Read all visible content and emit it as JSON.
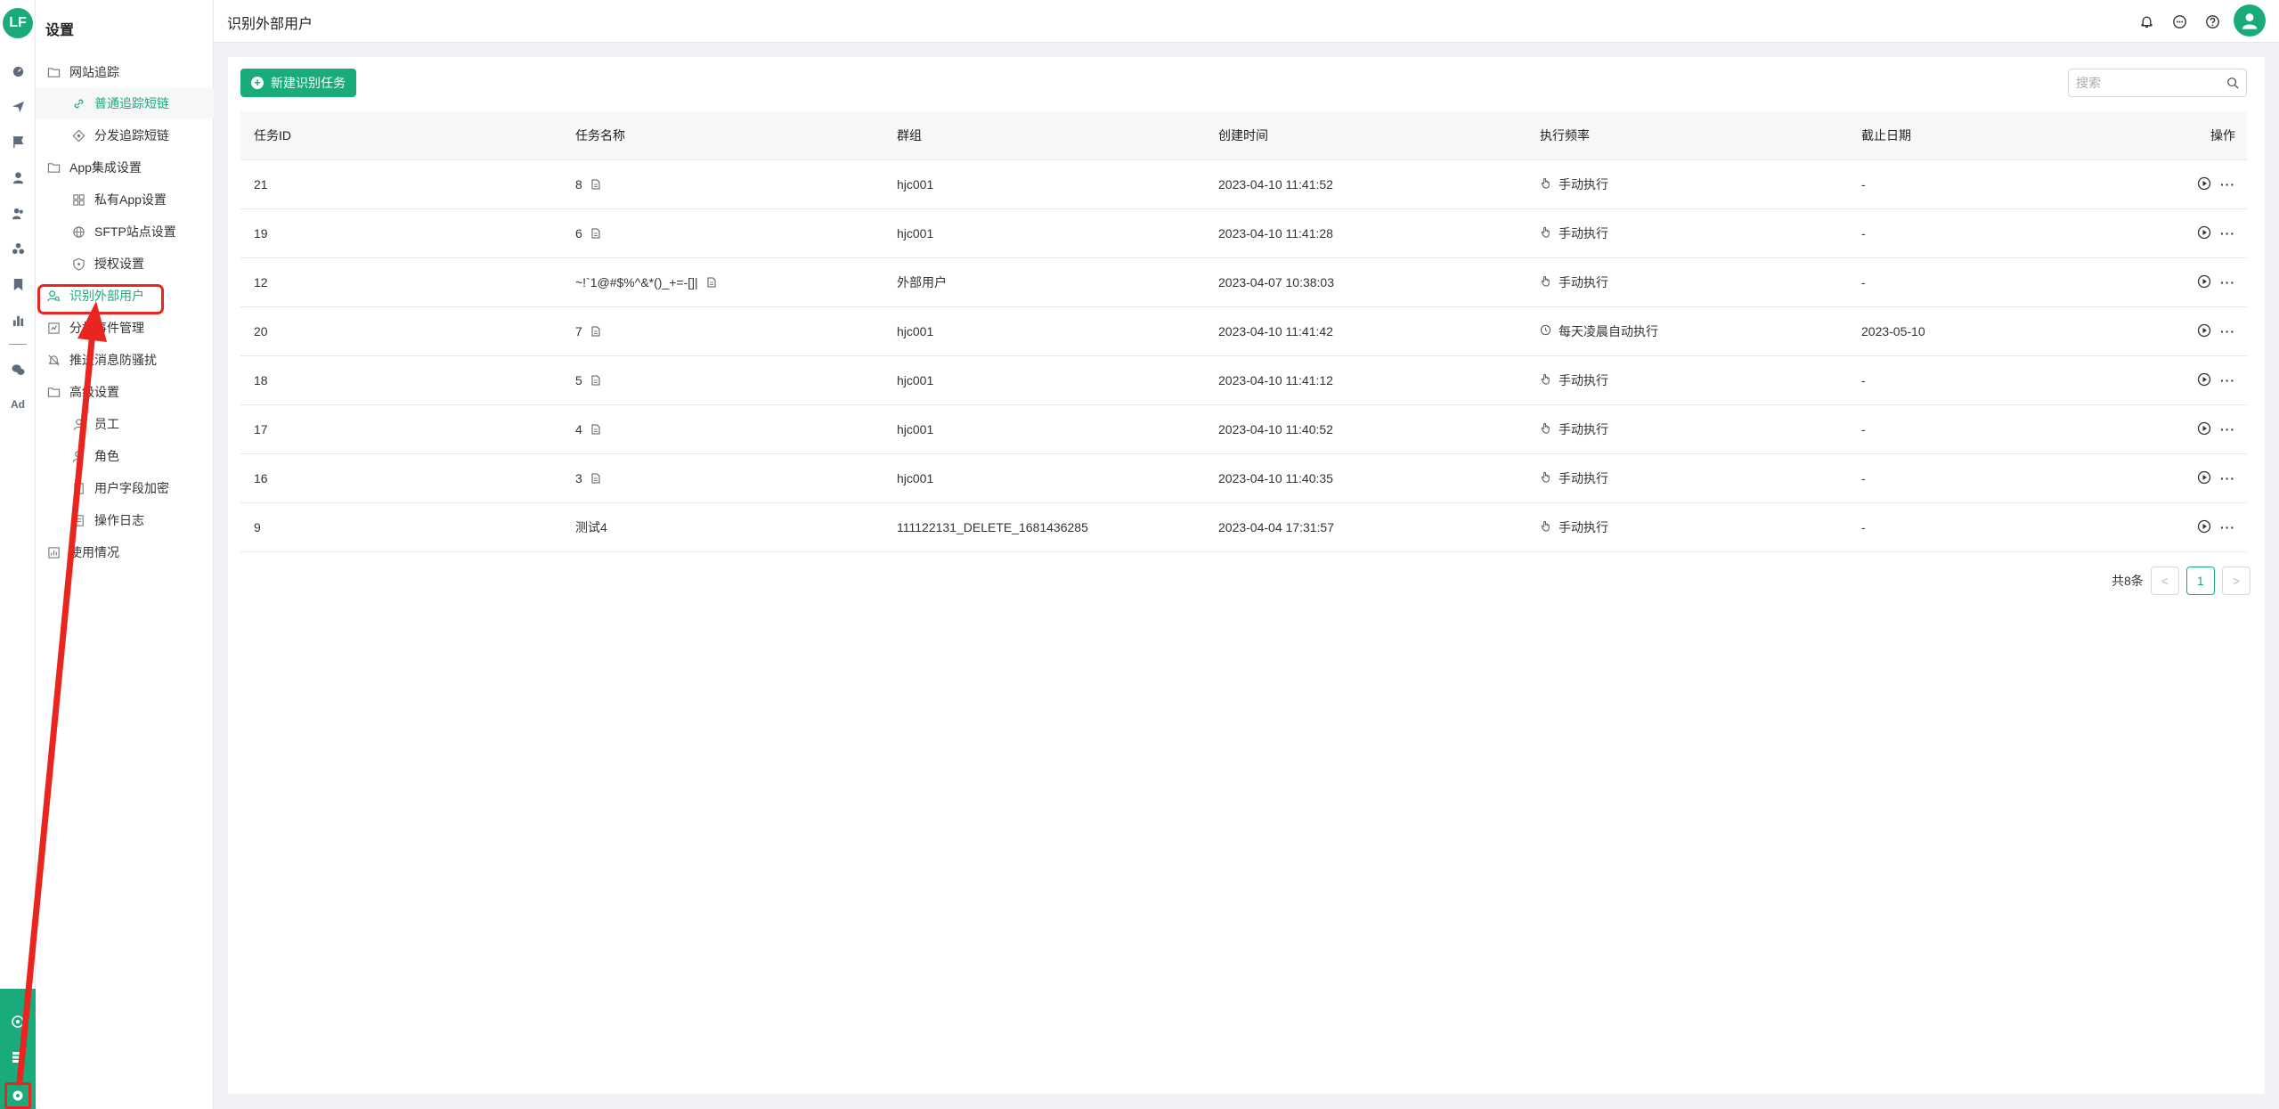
{
  "app": {
    "logo_text": "LF",
    "rail_ad_label": "Ad"
  },
  "sidebar": {
    "title": "设置",
    "items": [
      {
        "label": "网站追踪",
        "icon": "folder-icon",
        "level": 1
      },
      {
        "label": "普通追踪短链",
        "icon": "link-icon",
        "level": 2,
        "highlight": true
      },
      {
        "label": "分发追踪短链",
        "icon": "share-node-icon",
        "level": 2
      },
      {
        "label": "App集成设置",
        "icon": "folder-icon",
        "level": 1
      },
      {
        "label": "私有App设置",
        "icon": "apps-grid-icon",
        "level": 2
      },
      {
        "label": "SFTP站点设置",
        "icon": "globe-icon",
        "level": 2
      },
      {
        "label": "授权设置",
        "icon": "shield-icon",
        "level": 2
      },
      {
        "label": "识别外部用户",
        "icon": "user-search-icon",
        "level": 1,
        "active": true
      },
      {
        "label": "分析事件管理",
        "icon": "event-icon",
        "level": 1
      },
      {
        "label": "推送消息防骚扰",
        "icon": "bell-off-icon",
        "level": 1
      },
      {
        "label": "高级设置",
        "icon": "folder-icon",
        "level": 1
      },
      {
        "label": "员工",
        "icon": "user-icon",
        "level": 2
      },
      {
        "label": "角色",
        "icon": "role-icon",
        "level": 2
      },
      {
        "label": "用户字段加密",
        "icon": "lock-field-icon",
        "level": 2
      },
      {
        "label": "操作日志",
        "icon": "log-icon",
        "level": 2
      },
      {
        "label": "使用情况",
        "icon": "usage-icon",
        "level": 1
      }
    ]
  },
  "header": {
    "title": "识别外部用户"
  },
  "toolbar": {
    "new_task_label": "新建识别任务",
    "search_placeholder": "搜索"
  },
  "table": {
    "columns": [
      "任务ID",
      "任务名称",
      "群组",
      "创建时间",
      "执行频率",
      "截止日期",
      "操作"
    ],
    "rows": [
      {
        "id": "21",
        "name": "8",
        "has_doc": true,
        "group": "hjc001",
        "created": "2023-04-10 11:41:52",
        "freq": "手动执行",
        "freq_icon": "hand-icon",
        "deadline": "-"
      },
      {
        "id": "19",
        "name": "6",
        "has_doc": true,
        "group": "hjc001",
        "created": "2023-04-10 11:41:28",
        "freq": "手动执行",
        "freq_icon": "hand-icon",
        "deadline": "-"
      },
      {
        "id": "12",
        "name": "~!`1@#$%^&*()_+=-[]|",
        "has_doc": true,
        "group": "外部用户",
        "created": "2023-04-07 10:38:03",
        "freq": "手动执行",
        "freq_icon": "hand-icon",
        "deadline": "-"
      },
      {
        "id": "20",
        "name": "7",
        "has_doc": true,
        "group": "hjc001",
        "created": "2023-04-10 11:41:42",
        "freq": "每天凌晨自动执行",
        "freq_icon": "clock-icon",
        "deadline": "2023-05-10"
      },
      {
        "id": "18",
        "name": "5",
        "has_doc": true,
        "group": "hjc001",
        "created": "2023-04-10 11:41:12",
        "freq": "手动执行",
        "freq_icon": "hand-icon",
        "deadline": "-"
      },
      {
        "id": "17",
        "name": "4",
        "has_doc": true,
        "group": "hjc001",
        "created": "2023-04-10 11:40:52",
        "freq": "手动执行",
        "freq_icon": "hand-icon",
        "deadline": "-"
      },
      {
        "id": "16",
        "name": "3",
        "has_doc": true,
        "group": "hjc001",
        "created": "2023-04-10 11:40:35",
        "freq": "手动执行",
        "freq_icon": "hand-icon",
        "deadline": "-"
      },
      {
        "id": "9",
        "name": "测试4",
        "has_doc": false,
        "group": "111122131_DELETE_1681436285",
        "created": "2023-04-04 17:31:57",
        "freq": "手动执行",
        "freq_icon": "hand-icon",
        "deadline": "-"
      }
    ],
    "more_label": "···"
  },
  "pagination": {
    "total_label": "共8条",
    "prev": "<",
    "current": "1",
    "next": ">"
  },
  "colors": {
    "accent": "#1aab7c",
    "annotation": "#e8251f"
  }
}
